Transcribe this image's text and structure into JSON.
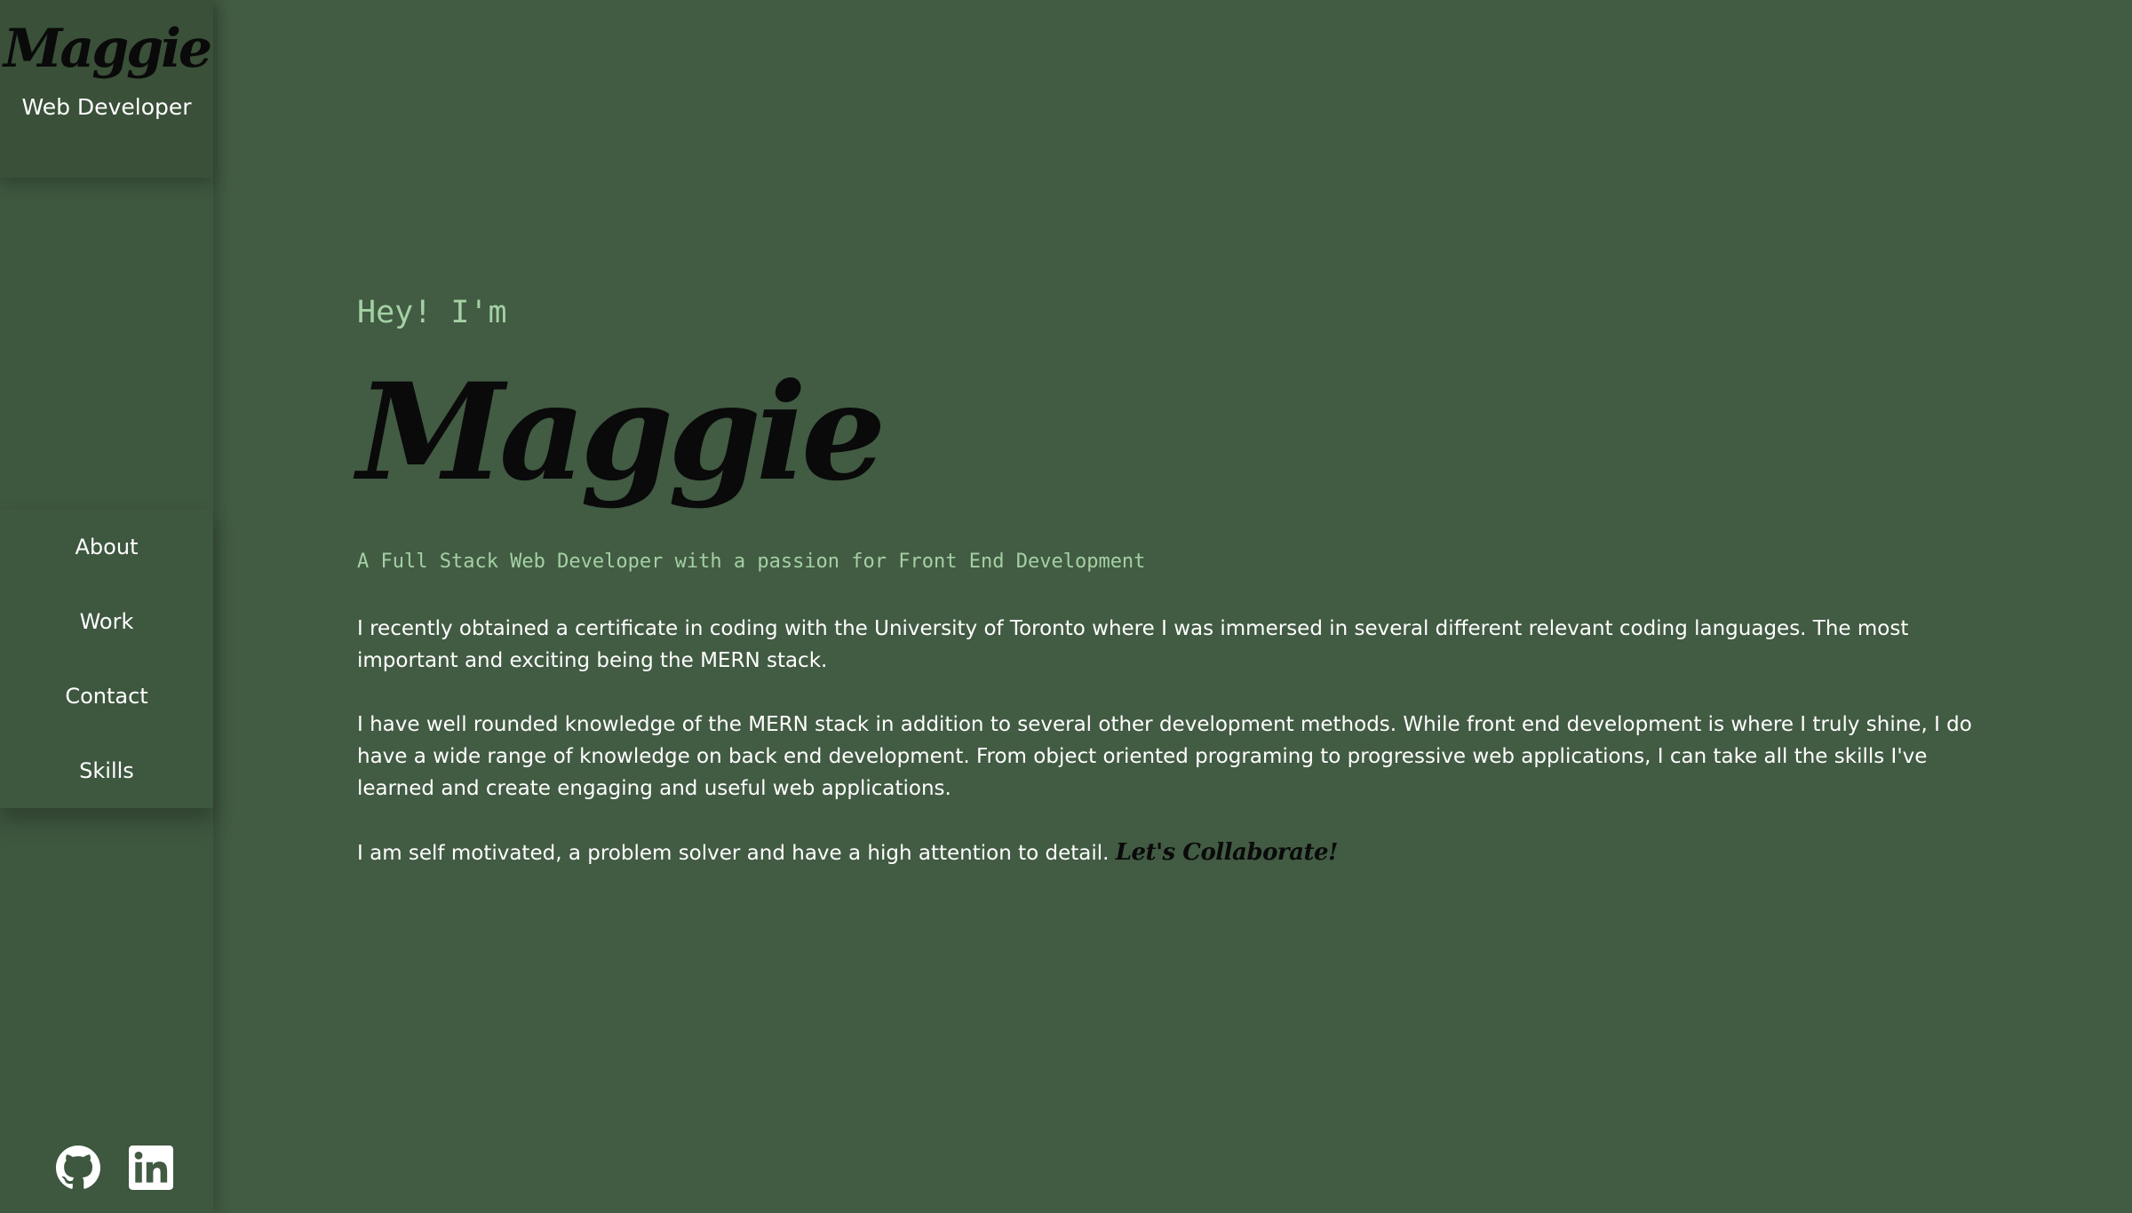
{
  "sidebar": {
    "brand_name": "Maggie",
    "brand_subtitle": "Web Developer",
    "nav": {
      "about": "About",
      "work": "Work",
      "contact": "Contact",
      "skills": "Skills"
    },
    "social": {
      "github_icon": "github-icon",
      "linkedin_icon": "linkedin-icon"
    }
  },
  "hero": {
    "greeting": "Hey! I'm",
    "name": "Maggie",
    "tagline": "A Full Stack Web Developer with a passion for Front End Development"
  },
  "about": {
    "paragraph1": "I recently obtained a certificate in coding with the University of Toronto where I was immersed in several different relevant coding languages. The most important and exciting being the MERN stack.",
    "paragraph2": "I have well rounded knowledge of the MERN stack in addition to several other development methods. While front end development is where I truly shine, I do have a wide range of knowledge on back end development. From object oriented programing to progressive web applications, I can take all the skills I've learned and create engaging and useful web applications.",
    "paragraph3": "I am self motivated, a problem solver and have a high attention to detail.",
    "collaborate": "Let's Collaborate!"
  },
  "colors": {
    "background": "#425b43",
    "sidebar": "#3e573f",
    "accent": "#a4d1a4",
    "text": "#ffffff",
    "script": "#0a0a0a"
  }
}
